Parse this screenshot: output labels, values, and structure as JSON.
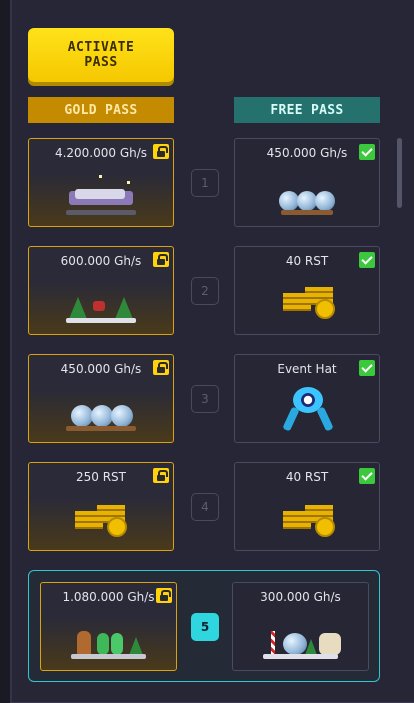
{
  "header": {
    "activate_label": "ACTIVATE\nPASS",
    "gold_pass_label": "GOLD PASS",
    "free_pass_label": "FREE PASS"
  },
  "rows": [
    {
      "level": "1",
      "gold": {
        "value": "4.200.000 Gh/s",
        "item": "miner-rig-purple",
        "locked": true
      },
      "free": {
        "value": "450.000 Gh/s",
        "item": "snow-globe-miner",
        "claimed": true
      }
    },
    {
      "level": "2",
      "gold": {
        "value": "600.000 Gh/s",
        "item": "christmas-trees-miner",
        "locked": true
      },
      "free": {
        "value": "40 RST",
        "item": "rst-coins",
        "claimed": true
      }
    },
    {
      "level": "3",
      "gold": {
        "value": "450.000 Gh/s",
        "item": "snow-globe-miner",
        "locked": true
      },
      "free": {
        "value": "Event Hat",
        "item": "event-hat",
        "claimed": true
      }
    },
    {
      "level": "4",
      "gold": {
        "value": "250 RST",
        "item": "rst-coins",
        "locked": true
      },
      "free": {
        "value": "40 RST",
        "item": "rst-coins",
        "claimed": true
      }
    },
    {
      "level": "5",
      "current": true,
      "gold": {
        "value": "1.080.000 Gh/s",
        "item": "gingerbread-miner",
        "locked": true
      },
      "free": {
        "value": "300.000 Gh/s",
        "item": "snowman-dog-miner",
        "claimed": false
      }
    }
  ],
  "colors": {
    "accent_yellow": "#ffd90a",
    "gold_header": "#c48a00",
    "free_header": "#24716e",
    "current_highlight": "#2fd6e0",
    "claimed_green": "#3cc83c"
  }
}
